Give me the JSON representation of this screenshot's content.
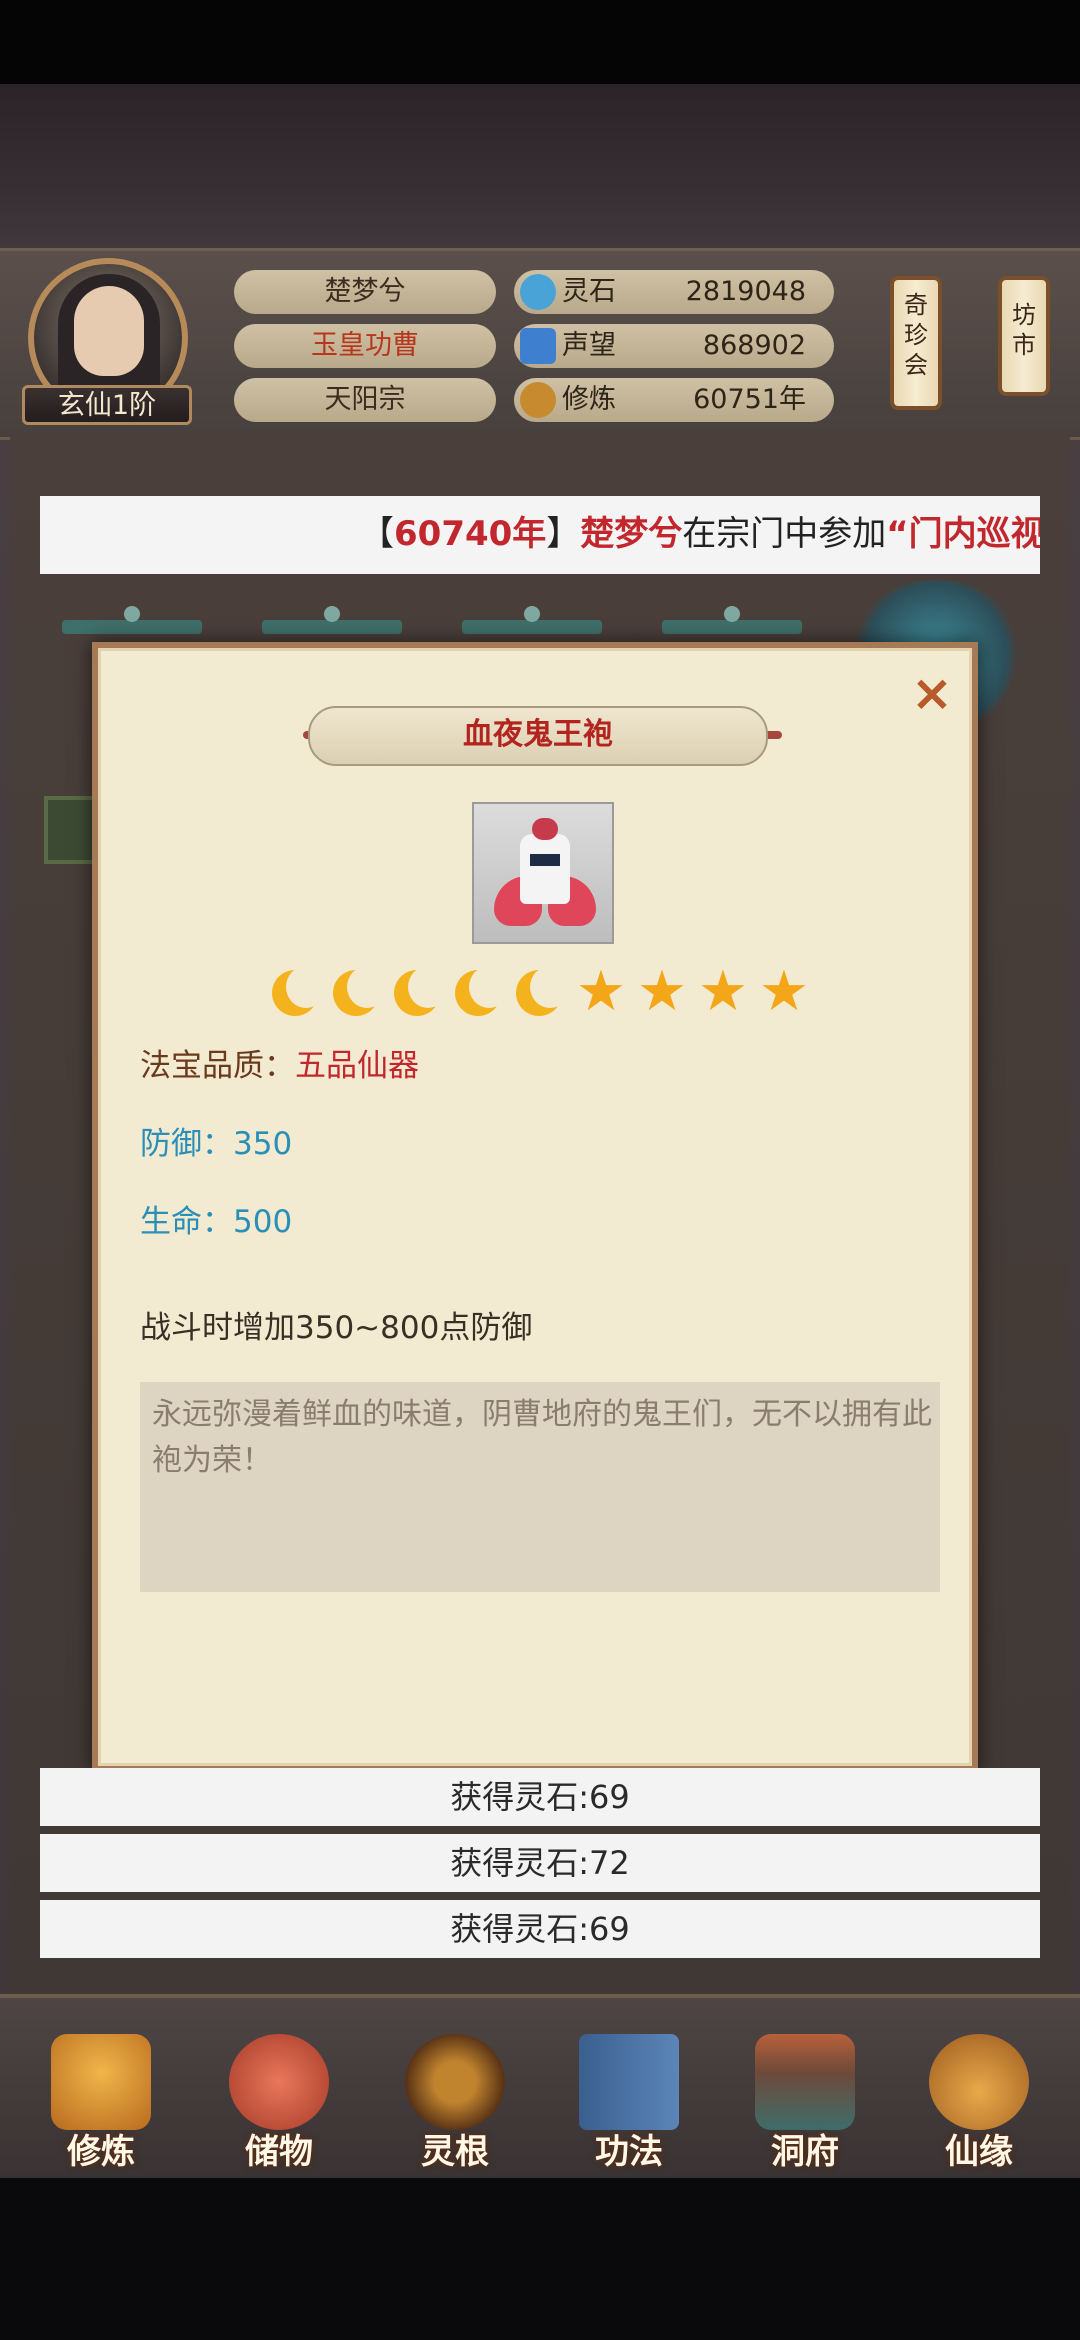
{
  "player": {
    "name": "楚梦兮",
    "title": "玉皇功曹",
    "sect": "天阳宗",
    "rank": "玄仙1阶"
  },
  "stats": [
    {
      "label": "灵石",
      "value": "2819048",
      "icon": "spirit-stone-icon",
      "color": "#4aa3d6"
    },
    {
      "label": "声望",
      "value": "868902",
      "icon": "prestige-icon",
      "color": "#3f7fd0"
    },
    {
      "label": "修炼",
      "value": "60751年",
      "icon": "cultivation-icon",
      "color": "#c78a2e"
    }
  ],
  "side_buttons": {
    "treasure_shop": "奇珍会",
    "market": "坊市"
  },
  "ticker": {
    "prefix": "【",
    "year": "60740年",
    "suffix": "】",
    "name": "楚梦兮",
    "text_mid": "在宗门中参加",
    "text_tail": "“门内巡视"
  },
  "dialog": {
    "item_name": "血夜鬼王袍",
    "close_symbol": "×",
    "rating": {
      "moons": 5,
      "stars": 4
    },
    "quality_label": "法宝品质：",
    "quality_value": "五品仙器",
    "defense_label": "防御：",
    "defense_value": "350",
    "life_label": "生命：",
    "life_value": "500",
    "effect": "战斗时增加350~800点防御",
    "description": "永远弥漫着鲜血的味道，阴曹地府的鬼王们，无不以拥有此袍为荣！"
  },
  "notifications": [
    "获得灵石:69",
    "获得灵石:72",
    "获得灵石:69"
  ],
  "nav": [
    {
      "label": "修炼",
      "icon": "cultivate-icon"
    },
    {
      "label": "储物",
      "icon": "storage-bag-icon"
    },
    {
      "label": "灵根",
      "icon": "spirit-root-icon"
    },
    {
      "label": "功法",
      "icon": "technique-book-icon"
    },
    {
      "label": "洞府",
      "icon": "cave-dwelling-icon"
    },
    {
      "label": "仙缘",
      "icon": "fortune-gourd-icon"
    }
  ]
}
